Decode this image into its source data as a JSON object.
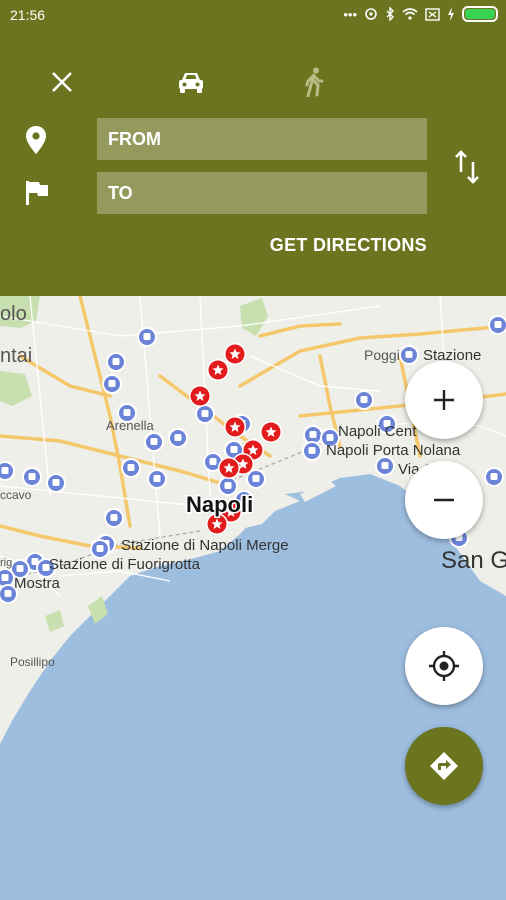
{
  "status_bar": {
    "time": "21:56",
    "dots": "•••"
  },
  "header": {
    "from_placeholder": "FROM",
    "to_placeholder": "TO",
    "get_directions": "GET DIRECTIONS",
    "modes": [
      "close-icon",
      "car-icon",
      "walk-icon"
    ]
  },
  "map": {
    "labels": {
      "olo": "olo",
      "ntai": "ntai",
      "arenella": "Arenella",
      "poggi": "Poggi",
      "stazione": "Stazione",
      "napoli_cent": "Napoli Cent",
      "napoli_porta_nolana": "Napoli Porta Nolana",
      "via_c": "Via C",
      "napoli": "Napoli",
      "ccavo": "ccavo",
      "stazione_merge": "Stazione di Napoli Merge",
      "stazione_fuori": "Stazione di Fuorigrotta",
      "mostra": "Mostra",
      "posillipo": "Posillipo",
      "san_g": "San G",
      "rig": "rig"
    }
  },
  "colors": {
    "header_bg": "#6b741f",
    "fab_directions": "#6b741f",
    "marker_red": "#e21c1c",
    "marker_blue": "#6b84d8",
    "sea": "#9ebee0",
    "land": "#efefea"
  }
}
